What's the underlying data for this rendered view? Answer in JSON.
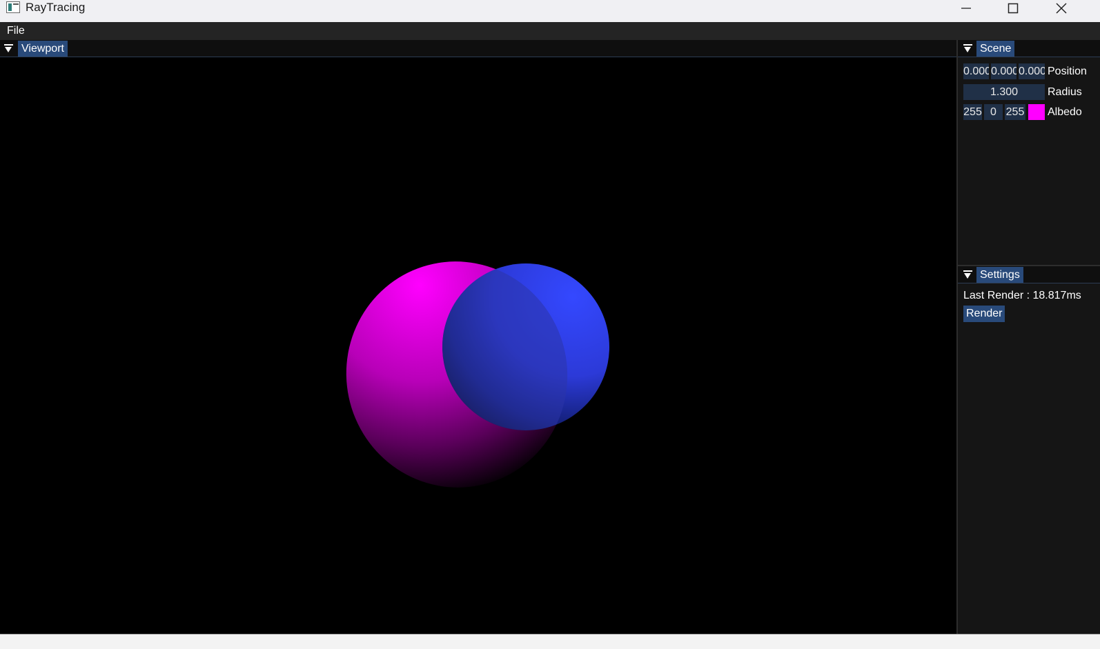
{
  "window": {
    "title": "RayTracing",
    "controls": [
      "minimize-icon",
      "maximize-icon",
      "close-icon"
    ]
  },
  "menu": {
    "file": "File"
  },
  "viewport": {
    "tab": "Viewport"
  },
  "scene": {
    "tab": "Scene",
    "position": {
      "x": "0.000",
      "y": "0.000",
      "z": "0.000",
      "label": "Position"
    },
    "radius": {
      "value": "1.300",
      "label": "Radius"
    },
    "albedo": {
      "r": "255",
      "g": "0",
      "b": "255",
      "label": "Albedo",
      "color": "#ff00ff"
    }
  },
  "settings": {
    "tab": "Settings",
    "last_render": "Last Render : 18.817ms",
    "render_button": "Render"
  },
  "colors": {
    "panel_tab": "#294a7a",
    "field_bg": "#203047",
    "magenta_sphere": "#ff00ff",
    "blue_sphere": "#2f44ff"
  }
}
